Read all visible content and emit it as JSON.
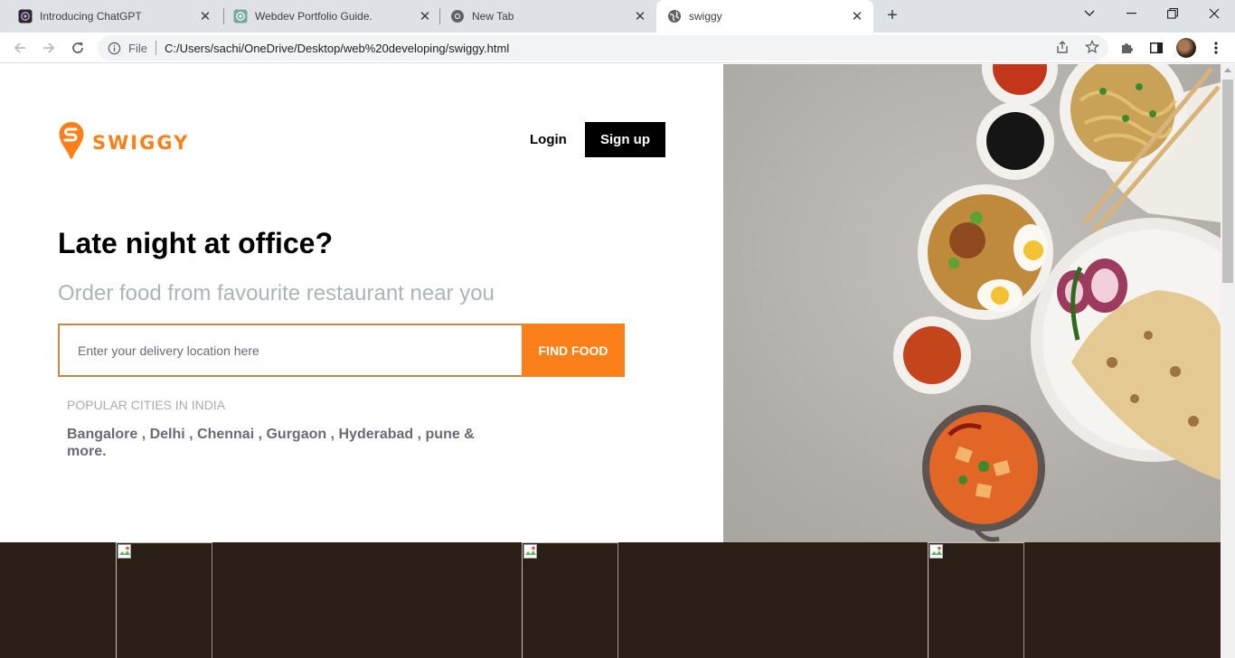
{
  "browser": {
    "tabs": [
      {
        "title": "Introducing ChatGPT",
        "icon": "chatgpt-icon"
      },
      {
        "title": "Webdev Portfolio Guide.",
        "icon": "chatgpt-icon"
      },
      {
        "title": "New Tab",
        "icon": "chrome-icon"
      },
      {
        "title": "swiggy",
        "icon": "globe-icon",
        "active": true
      }
    ],
    "address": {
      "scheme_label": "File",
      "url": "C:/Users/sachi/OneDrive/Desktop/web%20developing/swiggy.html"
    }
  },
  "page": {
    "brand": {
      "name": "SWIGGY",
      "color": "#fc8019"
    },
    "nav": {
      "login": "Login",
      "signup": "Sign up"
    },
    "headline": "Late night at office?",
    "subheadline": "Order food from favourite restaurant near you",
    "search": {
      "placeholder": "Enter your delivery location here",
      "value": "",
      "button": "FIND FOOD"
    },
    "popular_label": "POPULAR CITIES IN INDIA",
    "cities": "Bangalore , Delhi , Chennai , Gurgaon , Hyderabad , pune & more.",
    "colors": {
      "accent": "#fc8019",
      "footer_bg": "#2a1e16",
      "subtext": "#a9b5b8"
    }
  }
}
